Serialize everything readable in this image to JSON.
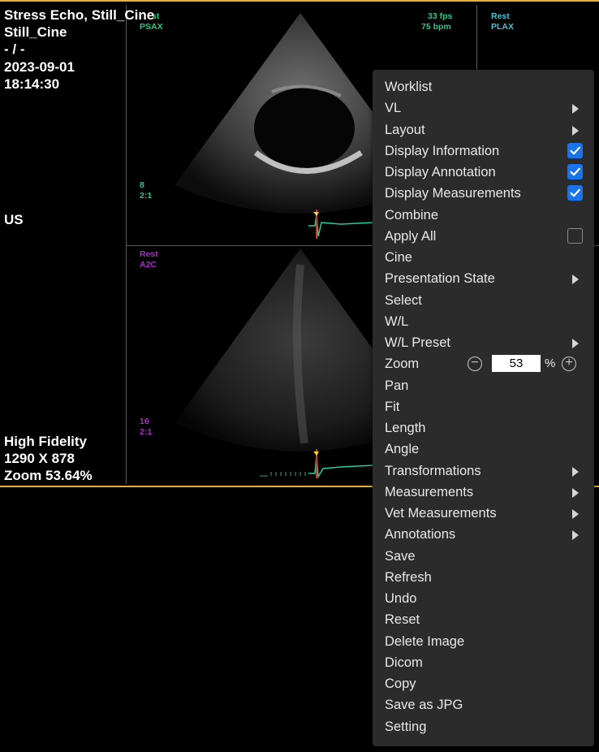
{
  "overlay": {
    "title_line1": "Stress Echo, Still_Cine",
    "title_line2": "Still_Cine",
    "title_line3": "- / -",
    "date": "2023-09-01",
    "time": "18:14:30",
    "modality": "US",
    "quality": "High Fidelity",
    "dimensions": "1290 X 878",
    "zoom": "Zoom 53.64%"
  },
  "panels": {
    "top_left": {
      "stage": "st",
      "view": "PSAX",
      "frame": "8",
      "ratio": "2:1",
      "fps": "33 fps",
      "bpm": "75 bpm"
    },
    "top_right": {
      "stage": "Rest",
      "view": "PLAX"
    },
    "bottom_left": {
      "stage": "Rest",
      "view": "A2C",
      "frame": "16",
      "ratio": "2:1"
    }
  },
  "menu": {
    "items": [
      {
        "label": "Worklist"
      },
      {
        "label": "VL",
        "submenu": true
      },
      {
        "label": "Layout",
        "submenu": true
      },
      {
        "label": "Display Information",
        "checked": true
      },
      {
        "label": "Display Annotation",
        "checked": true
      },
      {
        "label": "Display Measurements",
        "checked": true
      },
      {
        "label": "Combine"
      },
      {
        "label": "Apply All",
        "checked": false
      },
      {
        "label": "Cine"
      },
      {
        "label": "Presentation State",
        "submenu": true
      },
      {
        "label": "Select"
      },
      {
        "label": "W/L"
      },
      {
        "label": "W/L Preset",
        "submenu": true
      },
      {
        "label": "Zoom",
        "zoom_value": "53",
        "zoom_unit": "%"
      },
      {
        "label": "Pan"
      },
      {
        "label": "Fit"
      },
      {
        "label": "Length"
      },
      {
        "label": "Angle"
      },
      {
        "label": "Transformations",
        "submenu": true
      },
      {
        "label": "Measurements",
        "submenu": true
      },
      {
        "label": "Vet Measurements",
        "submenu": true
      },
      {
        "label": "Annotations",
        "submenu": true
      },
      {
        "label": "Save"
      },
      {
        "label": "Refresh"
      },
      {
        "label": "Undo"
      },
      {
        "label": "Reset"
      },
      {
        "label": "Delete Image"
      },
      {
        "label": "Dicom"
      },
      {
        "label": "Copy"
      },
      {
        "label": "Save as JPG"
      },
      {
        "label": "Setting"
      }
    ]
  },
  "colors": {
    "accent_border": "#e4b23a",
    "checkbox_on": "#1a73e8",
    "menu_bg": "#2b2b2b",
    "label_green": "#25c98a",
    "label_cyan": "#3fc6d6",
    "label_purple": "#a531c2"
  }
}
